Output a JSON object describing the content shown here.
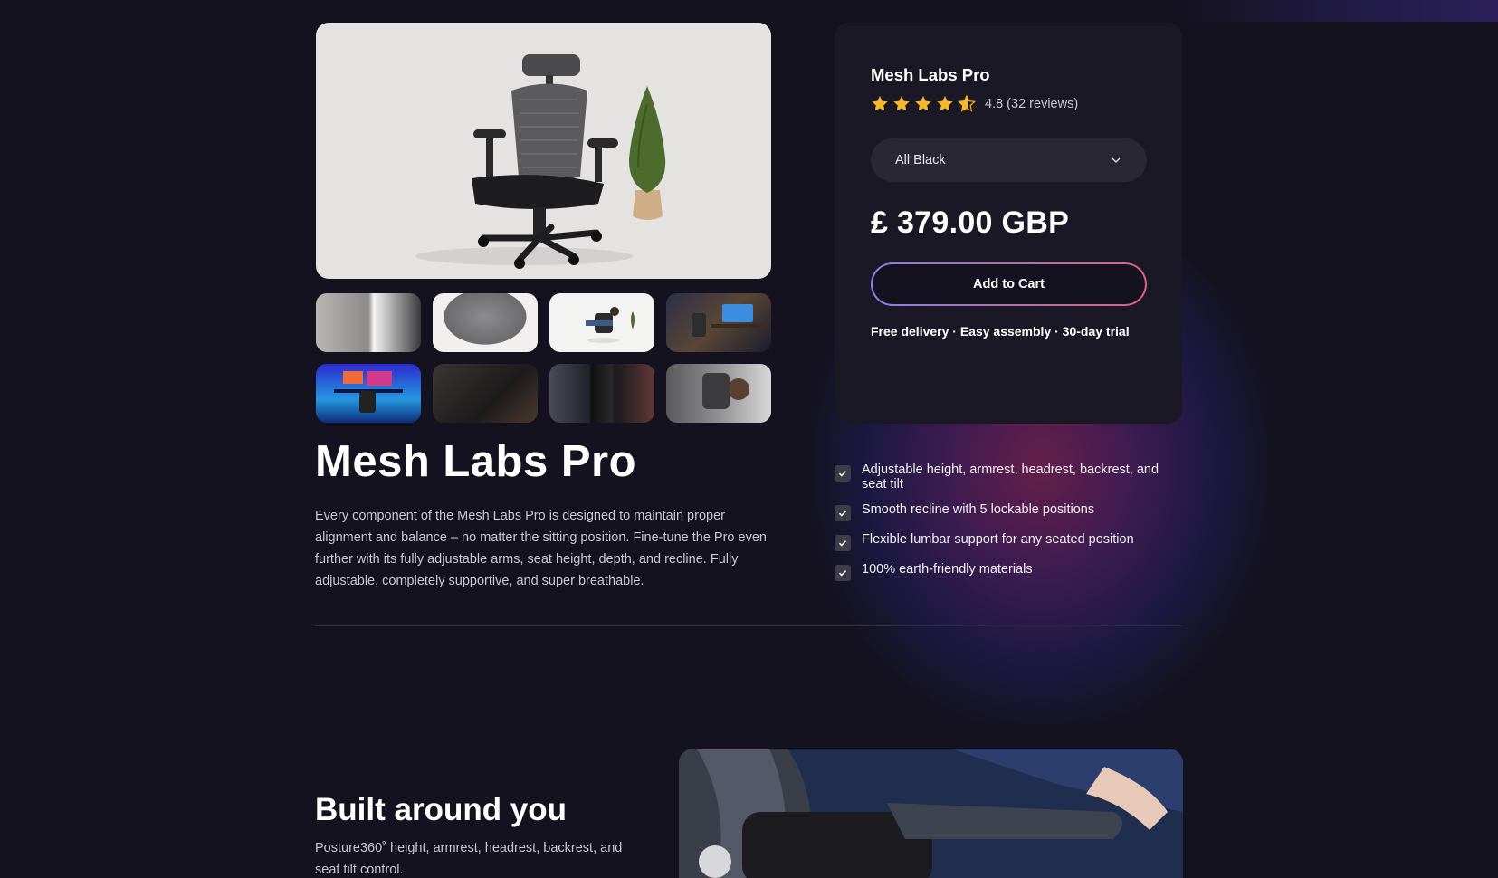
{
  "product": {
    "title": "Mesh Labs Pro",
    "description": "Every component of the Mesh Labs Pro is designed to maintain proper alignment and balance – no matter the sitting position. Fine-tune the Pro even further with its fully adjustable arms, seat height, depth, and recline. Fully adjustable, completely supportive, and super breathable."
  },
  "gallery": {
    "main_image": "office-chair-with-plant",
    "thumbnails": [
      "mesh-backrest-closeup",
      "seat-cushion",
      "person-reclining-in-chair",
      "chair-at-desk-setup",
      "blue-lit-gaming-setup",
      "dark-office-setup",
      "chair-angles-collage",
      "headrest-side-view"
    ]
  },
  "buy_box": {
    "title": "Mesh Labs Pro",
    "rating": 4.8,
    "rating_text": "4.8 (32 reviews)",
    "variant": "All Black",
    "price": "£ 379.00 GBP",
    "cart_label": "Add to Cart",
    "delivery": "Free delivery · Easy assembly · 30-day trial"
  },
  "features": [
    "Adjustable height, armrest, headrest, backrest, and seat tilt",
    "Smooth recline with 5 lockable positions",
    "Flexible lumbar support for any seated position",
    "100% earth-friendly materials"
  ],
  "section": {
    "title": "Built around you",
    "desc": "Posture360˚ height, armrest, headrest, backrest, and seat tilt control.",
    "image": "hand-adjusting-armrest"
  },
  "colors": {
    "background": "#14121f",
    "card": "#1b1826",
    "star": "#f5b82e",
    "button_gradient_start": "#8a7fe8",
    "button_gradient_end": "#e0607f"
  }
}
